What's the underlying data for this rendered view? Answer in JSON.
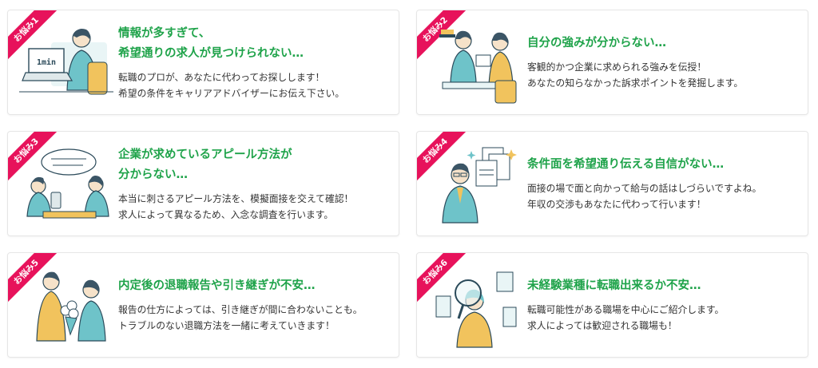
{
  "colors": {
    "title_green": "#1fa34a",
    "ribbon_pink": "#e7125b",
    "accent_teal": "#6ec3c9",
    "accent_yellow": "#f1c35d"
  },
  "cards": [
    {
      "badge": "お悩み1",
      "title": "情報が多すぎて、\n希望通りの求人が見つけられない…",
      "body": "転職のプロが、あなたに代わってお探しします！\n希望の条件をキャリアアドバイザーにお伝え下さい。",
      "illustration": "person-laptop-1min",
      "laptop_text": "1min"
    },
    {
      "badge": "お悩み2",
      "title": "自分の強みが分からない…",
      "body": "客観的かつ企業に求められる強みを伝授！\nあなたの知らなかった訴求ポイントを発掘します。",
      "illustration": "interview-two-people"
    },
    {
      "badge": "お悩み3",
      "title": "企業が求めているアピール方法が\n分からない…",
      "body": "本当に刺さるアピール方法を、模擬面接を交えて確認！\n求人によって異なるため、入念な調査を行います。",
      "illustration": "mock-interview"
    },
    {
      "badge": "お悩み4",
      "title": "条件面を希望通り伝える自信がない…",
      "body": "面接の場で面と向かって給与の話はしづらいですよね。\n年収の交渉もあなたに代わって行います！",
      "illustration": "person-documents"
    },
    {
      "badge": "お悩み5",
      "title": "内定後の退職報告や引き継ぎが不安…",
      "body": "報告の仕方によっては、引き継ぎが間に合わないことも。\nトラブルのない退職方法を一緒に考えていきます！",
      "illustration": "flower-bouquet"
    },
    {
      "badge": "お悩み6",
      "title": "未経験業種に転職出来るか不安…",
      "body": "転職可能性がある職場を中心にご紹介します。\n求人によっては歓迎される職場も！",
      "illustration": "magnifier-buildings"
    }
  ]
}
